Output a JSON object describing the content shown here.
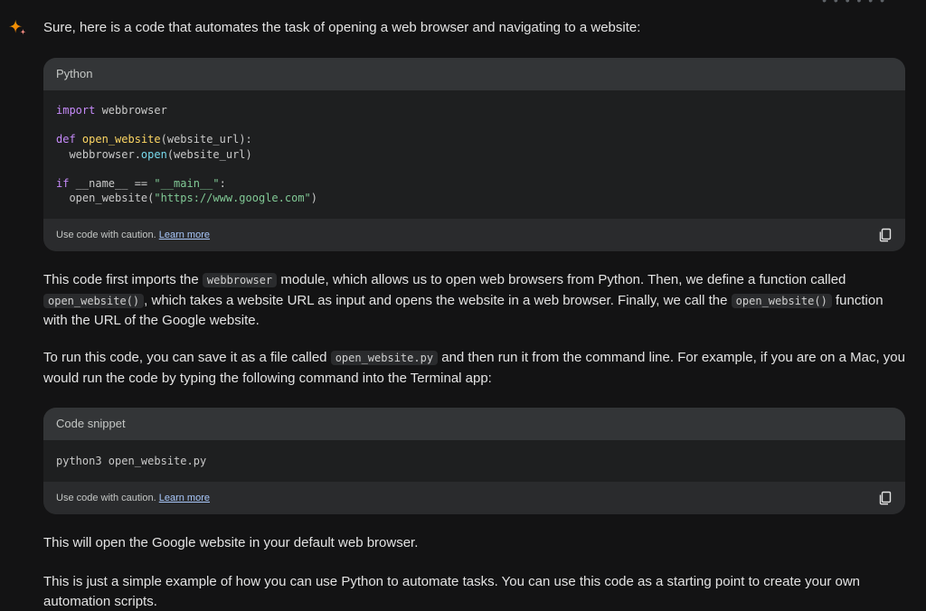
{
  "intro": "Sure, here is a code that automates the task of opening a web browser and navigating to a website:",
  "code_block_1": {
    "language": "Python",
    "lines": {
      "l1_kw": "import",
      "l1_rest": " webbrowser",
      "l3_kw": "def",
      "l3_fn": "open_website",
      "l3_rest": "(website_url):",
      "l4_a": "  webbrowser.",
      "l4_attr": "open",
      "l4_b": "(website_url)",
      "l6_kw": "if",
      "l6_a": " __name__ == ",
      "l6_str": "\"__main__\"",
      "l6_b": ":",
      "l7_a": "  open_website(",
      "l7_str": "\"https://www.google.com\"",
      "l7_b": ")"
    },
    "caution": "Use code with caution.",
    "learn_more": "Learn more"
  },
  "paragraph_1": {
    "t1": "This code first imports the ",
    "c1": "webbrowser",
    "t2": " module, which allows us to open web browsers from Python. Then, we define a function called ",
    "c2": "open_website()",
    "t3": ", which takes a website URL as input and opens the website in a web browser. Finally, we call the ",
    "c3": "open_website()",
    "t4": " function with the URL of the Google website."
  },
  "paragraph_2": {
    "t1": "To run this code, you can save it as a file called ",
    "c1": "open_website.py",
    "t2": " and then run it from the command line. For example, if you are on a Mac, you would run the code by typing the following command into the Terminal app:"
  },
  "code_block_2": {
    "language": "Code snippet",
    "code": "python3 open_website.py",
    "caution": "Use code with caution.",
    "learn_more": "Learn more"
  },
  "paragraph_3": "This will open the Google website in your default web browser.",
  "paragraph_4": "This is just a simple example of how you can use Python to automate tasks. You can use this code as a starting point to create your own automation scripts.",
  "icons": {
    "assistant": "sparkle-icon",
    "copy": "copy-icon"
  }
}
